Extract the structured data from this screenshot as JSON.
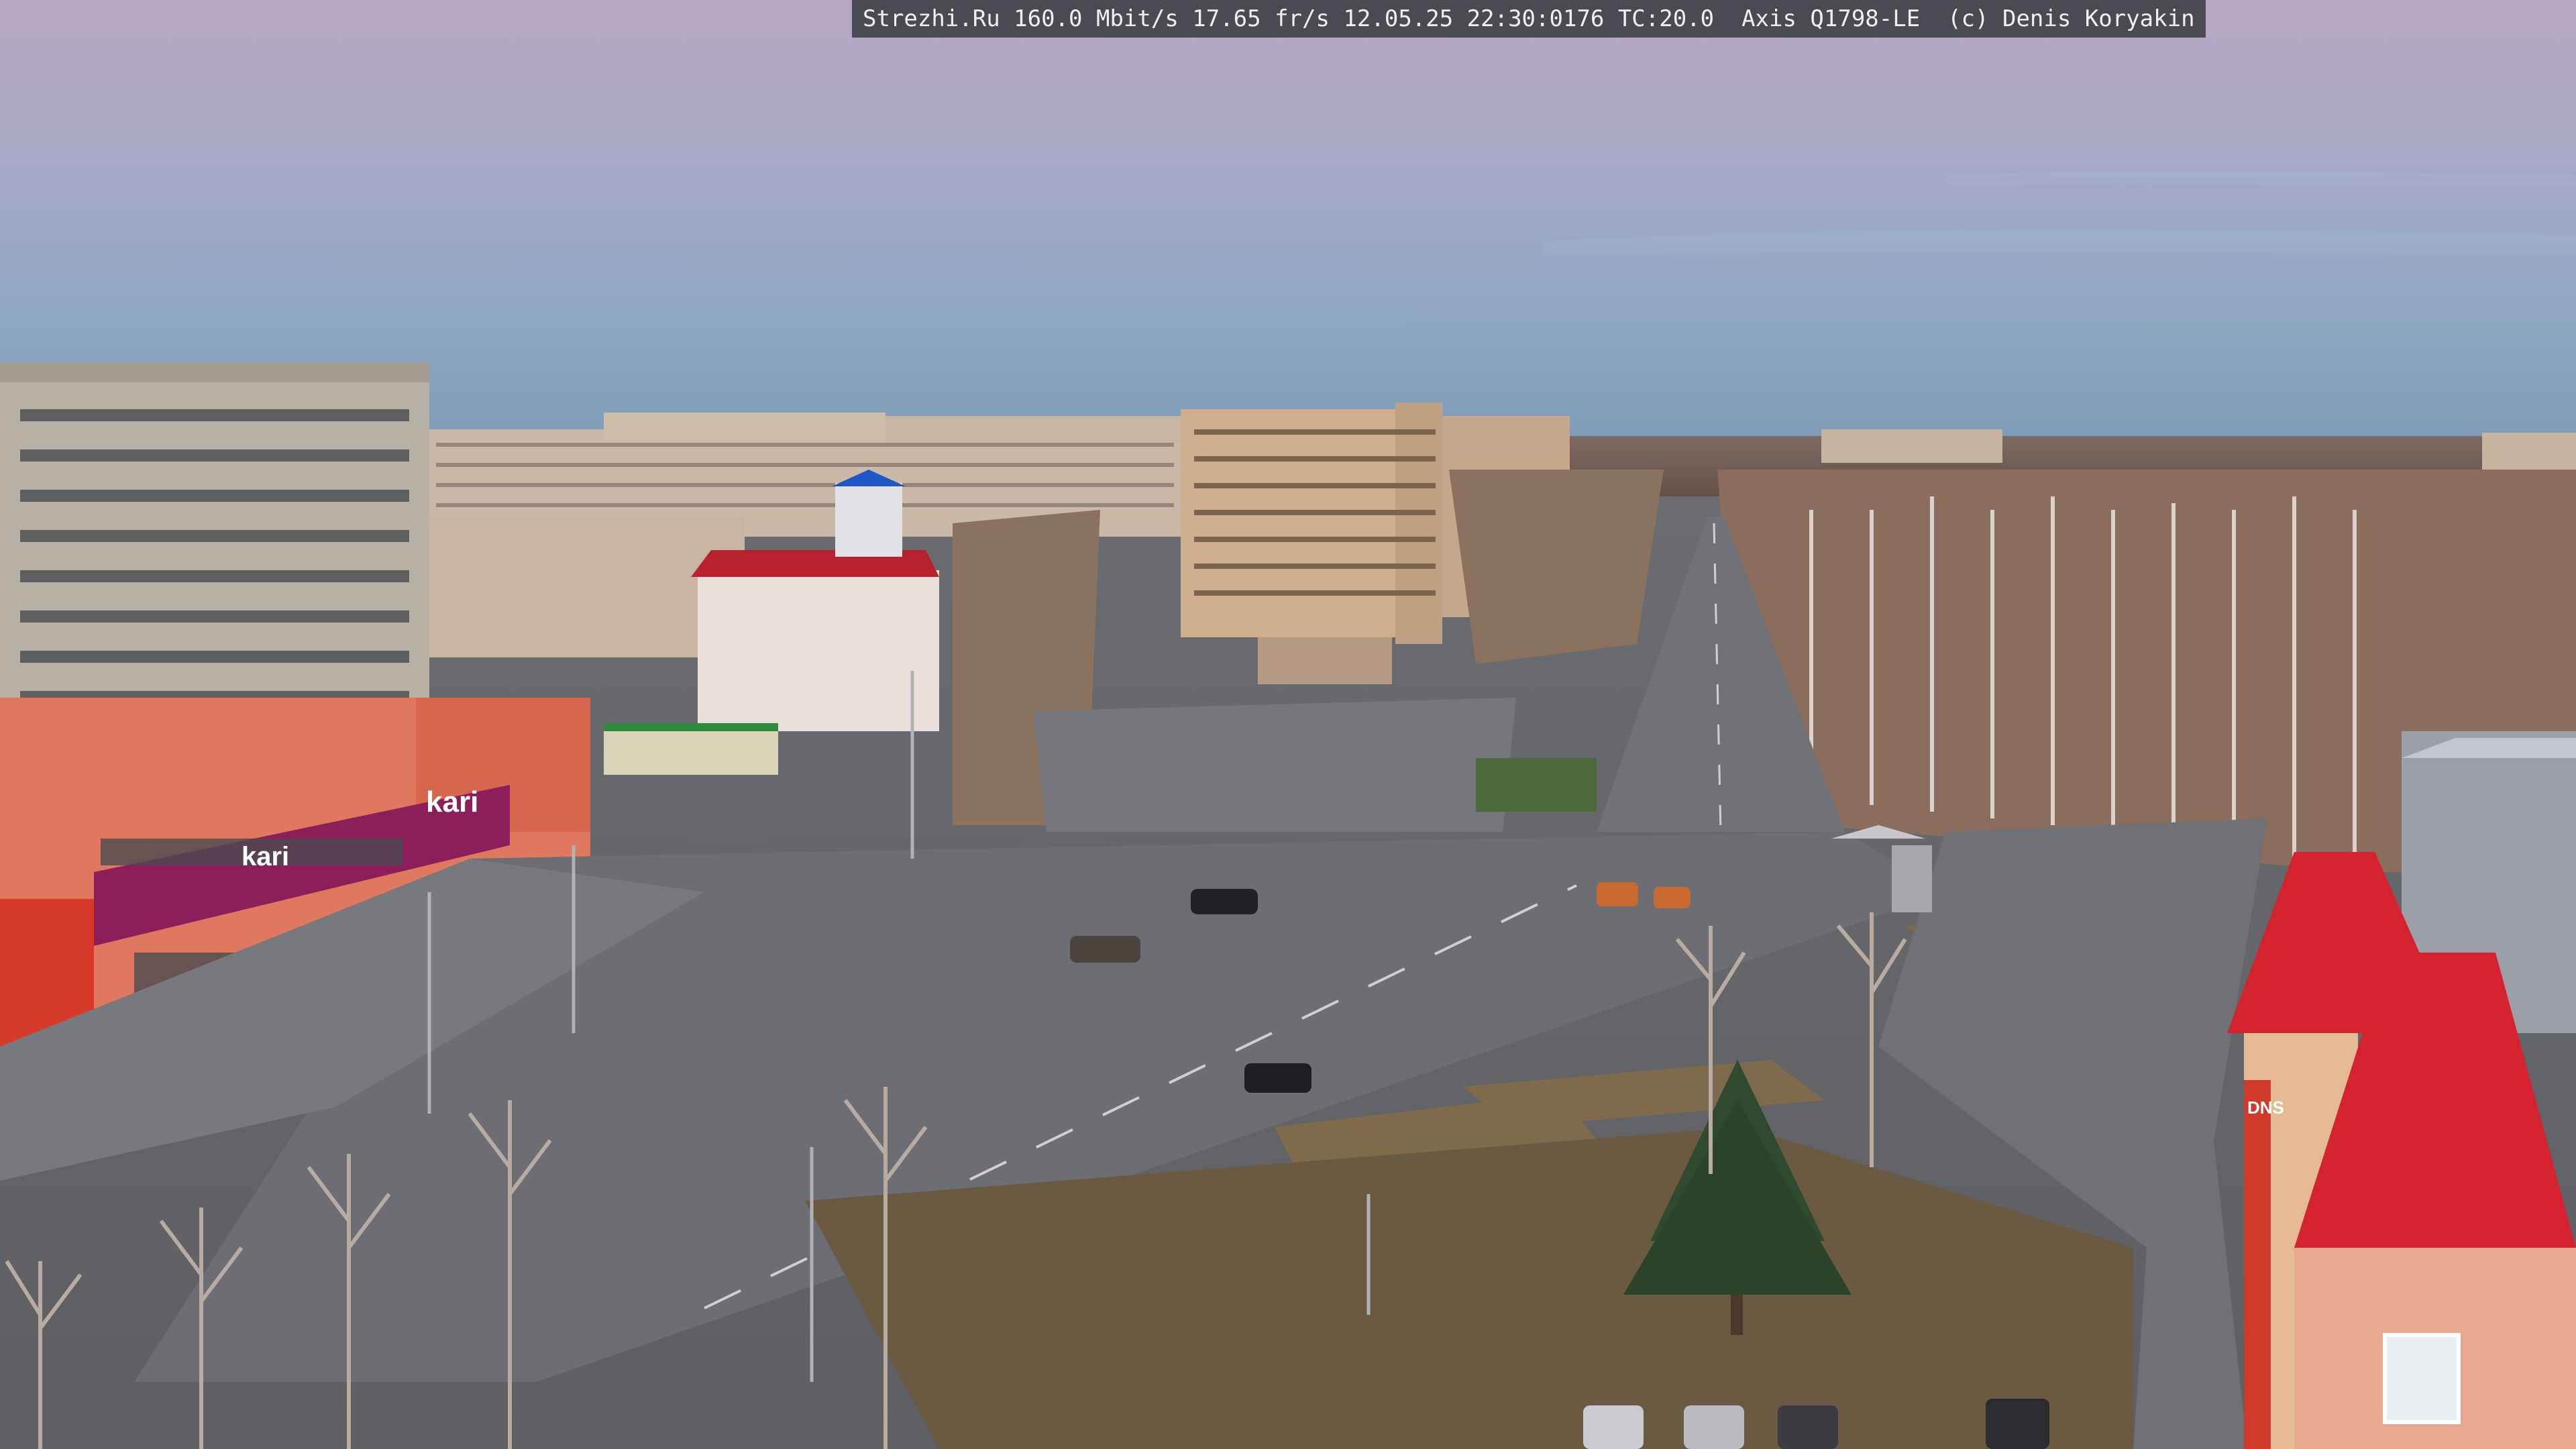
{
  "overlay": {
    "text": "Strezhi.Ru 160.0 Mbit/s 17.65 fr/s 12.05.25 22:30:0176 TC:20.0  Axis Q1798-LE  (c) Denis Koryakin"
  },
  "signs": {
    "kari_large": "kari",
    "kari_small": "kari",
    "dns": "DNS"
  },
  "colors": {
    "sky_top": "#b8a9c4",
    "sky_mid": "#9fb0c8",
    "sky_low": "#7f9cb8",
    "asphalt": "#6e7076",
    "kari_magenta": "#8c1f5a",
    "roof_red": "#d4232e",
    "birch_bare": "#8a6d5c"
  }
}
